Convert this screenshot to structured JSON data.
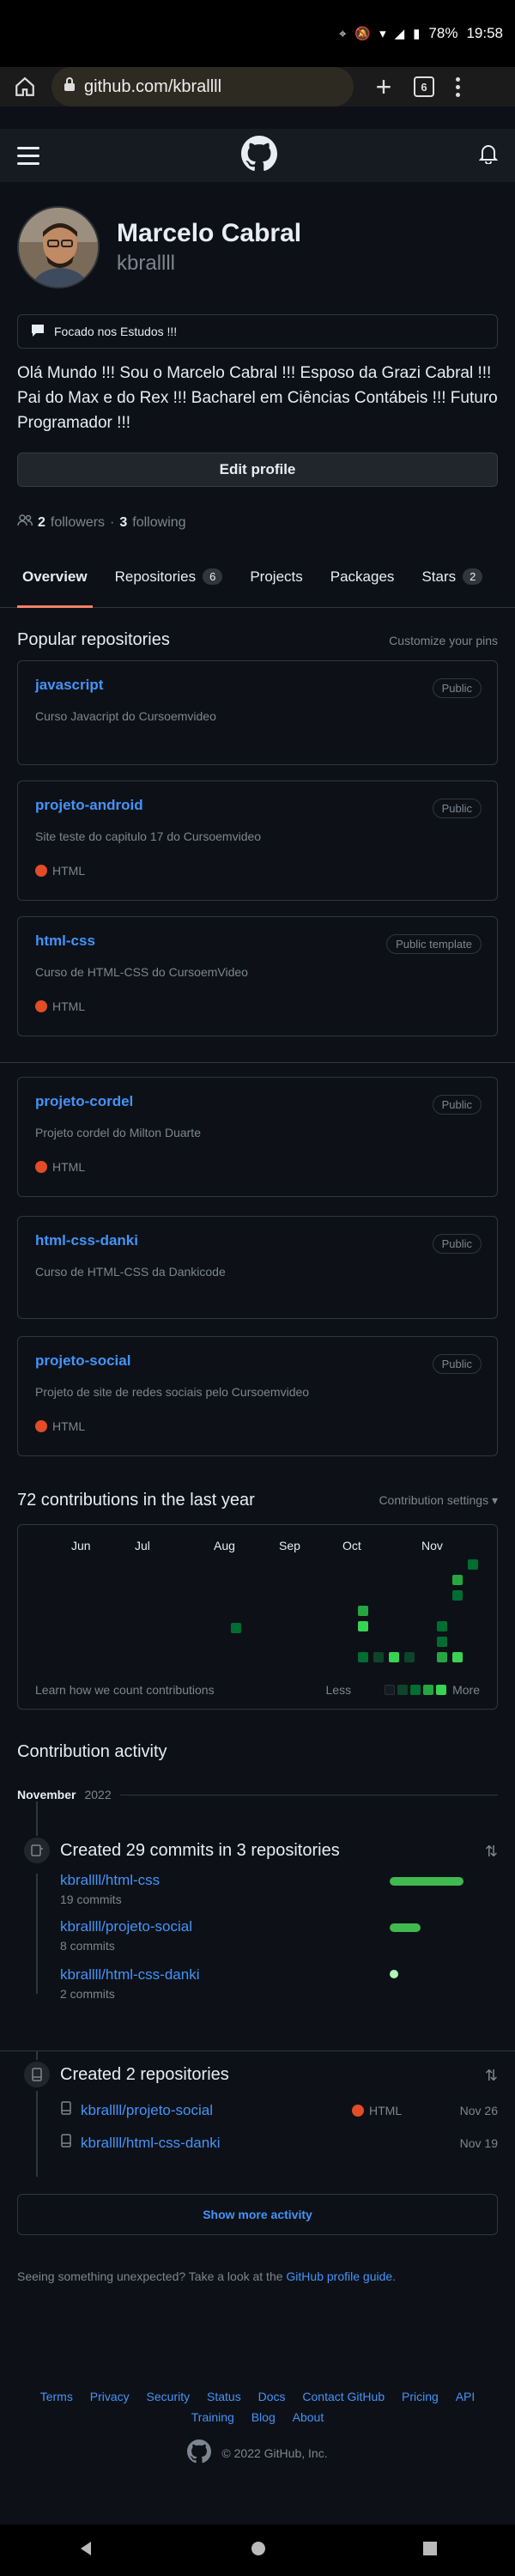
{
  "status_bar": {
    "battery": "78%",
    "time": "19:58"
  },
  "browser": {
    "url": "github.com/kbrallll",
    "tab_count": "6"
  },
  "profile": {
    "name": "Marcelo Cabral",
    "login": "kbrallll",
    "status": "Focado nos Estudos !!!",
    "bio": "Olá Mundo !!! Sou o Marcelo Cabral !!! Esposo da Grazi Cabral !!! Pai do Max e do Rex !!! Bacharel em Ciências Contábeis !!! Futuro Programador !!!",
    "edit_label": "Edit profile",
    "followers_count": "2",
    "followers_label": "followers",
    "following_count": "3",
    "following_label": "following"
  },
  "tabs": [
    {
      "label": "Overview",
      "count": ""
    },
    {
      "label": "Repositories",
      "count": "6"
    },
    {
      "label": "Projects",
      "count": ""
    },
    {
      "label": "Packages",
      "count": ""
    },
    {
      "label": "Stars",
      "count": "2"
    }
  ],
  "popular": {
    "title": "Popular repositories",
    "customize": "Customize your pins",
    "repos": [
      {
        "name": "javascript",
        "visibility": "Public",
        "description": "Curso Javacript do Cursoemvideo",
        "language": ""
      },
      {
        "name": "projeto-android",
        "visibility": "Public",
        "description": "Site teste do capitulo 17 do Cursoemvideo",
        "language": "HTML"
      },
      {
        "name": "html-css",
        "visibility": "Public template",
        "description": "Curso de HTML-CSS do CursoemVideo",
        "language": "HTML"
      },
      {
        "name": "projeto-cordel",
        "visibility": "Public",
        "description": "Projeto cordel do Milton Duarte",
        "language": "HTML"
      },
      {
        "name": "html-css-danki",
        "visibility": "Public",
        "description": "Curso de HTML-CSS da Dankicode",
        "language": ""
      },
      {
        "name": "projeto-social",
        "visibility": "Public",
        "description": "Projeto de site de redes sociais pelo Cursoemvideo",
        "language": "HTML"
      }
    ]
  },
  "contributions": {
    "title": "72 contributions in the last year",
    "settings": "Contribution settings",
    "months": [
      "Jun",
      "Jul",
      "Aug",
      "Sep",
      "Oct",
      "Nov"
    ],
    "learn": "Learn how we count contributions",
    "less": "Less",
    "more": "More",
    "level_colors": [
      "#161b22",
      "#0e4429",
      "#006d32",
      "#26a641",
      "#39d353"
    ]
  },
  "activity": {
    "title": "Contribution activity",
    "month": "November",
    "year": "2022",
    "commits_title": "Created 29 commits in 3 repositories",
    "commit_repos": [
      {
        "name": "kbrallll/html-css",
        "count": "19 commits",
        "share": 1.0
      },
      {
        "name": "kbrallll/projeto-social",
        "count": "8 commits",
        "share": 0.42
      },
      {
        "name": "kbrallll/html-css-danki",
        "count": "2 commits",
        "share": 0.1
      }
    ],
    "repos_title": "Created 2 repositories",
    "created_repos": [
      {
        "name": "kbrallll/projeto-social",
        "language": "HTML",
        "date": "Nov 26"
      },
      {
        "name": "kbrallll/html-css-danki",
        "language": "",
        "date": "Nov 19"
      }
    ],
    "show_more": "Show more activity",
    "unexpected": "Seeing something unexpected? Take a look at the",
    "guide": "GitHub profile guide",
    "guide_end": "."
  },
  "footer": {
    "links": [
      "Terms",
      "Privacy",
      "Security",
      "Status",
      "Docs",
      "Contact GitHub",
      "Pricing",
      "API",
      "Training",
      "Blog",
      "About"
    ],
    "copyright": "© 2022 GitHub, Inc."
  }
}
